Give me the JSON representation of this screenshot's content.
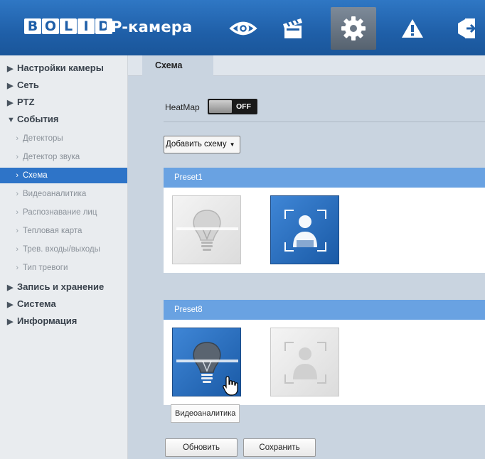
{
  "header": {
    "logo_letters": [
      "B",
      "O",
      "L",
      "I",
      "D"
    ],
    "title": "IP-камера",
    "nav": [
      {
        "icon": "eye-icon",
        "label": "Просмотр"
      },
      {
        "icon": "clapperboard-icon",
        "label": "Воспроизведение"
      },
      {
        "icon": "gear-icon",
        "label": "Настройки",
        "active": true
      },
      {
        "icon": "warning-icon",
        "label": "Тревога"
      },
      {
        "icon": "logout-icon",
        "label": "Выход"
      }
    ],
    "colors": {
      "bar": "#1f5fa8",
      "active_tab": "#6b7785"
    }
  },
  "sidebar": {
    "items": [
      {
        "label": "Настройки камеры",
        "expanded": false
      },
      {
        "label": "Сеть",
        "expanded": false
      },
      {
        "label": "PTZ",
        "expanded": false
      },
      {
        "label": "События",
        "expanded": true
      }
    ],
    "sub_items": [
      {
        "label": "Детекторы"
      },
      {
        "label": "Детектор звука"
      },
      {
        "label": "Схема",
        "active": true
      },
      {
        "label": "Видеоаналитика"
      },
      {
        "label": "Распознавание лиц"
      },
      {
        "label": "Тепловая карта"
      },
      {
        "label": "Трев. входы/выходы"
      },
      {
        "label": "Тип тревоги"
      }
    ],
    "items_after": [
      {
        "label": "Запись и хранение"
      },
      {
        "label": "Система"
      },
      {
        "label": "Информация"
      }
    ],
    "colors": {
      "active": "#2e74c8"
    }
  },
  "main": {
    "tab": "Схема",
    "heatmap": {
      "label": "HeatMap",
      "state": "OFF"
    },
    "add_scheme": "Добавить схему",
    "presets": [
      {
        "name": "Preset1",
        "tiles": [
          {
            "icon": "lightbulb-icon",
            "active": false
          },
          {
            "icon": "face-detection-icon",
            "active": true
          }
        ]
      },
      {
        "name": "Preset8",
        "tiles": [
          {
            "icon": "lightbulb-icon",
            "active": true
          },
          {
            "icon": "face-detection-icon",
            "active": false
          }
        ]
      }
    ],
    "tooltip": "Видеоаналитика",
    "buttons": {
      "refresh": "Обновить",
      "save": "Сохранить"
    }
  }
}
